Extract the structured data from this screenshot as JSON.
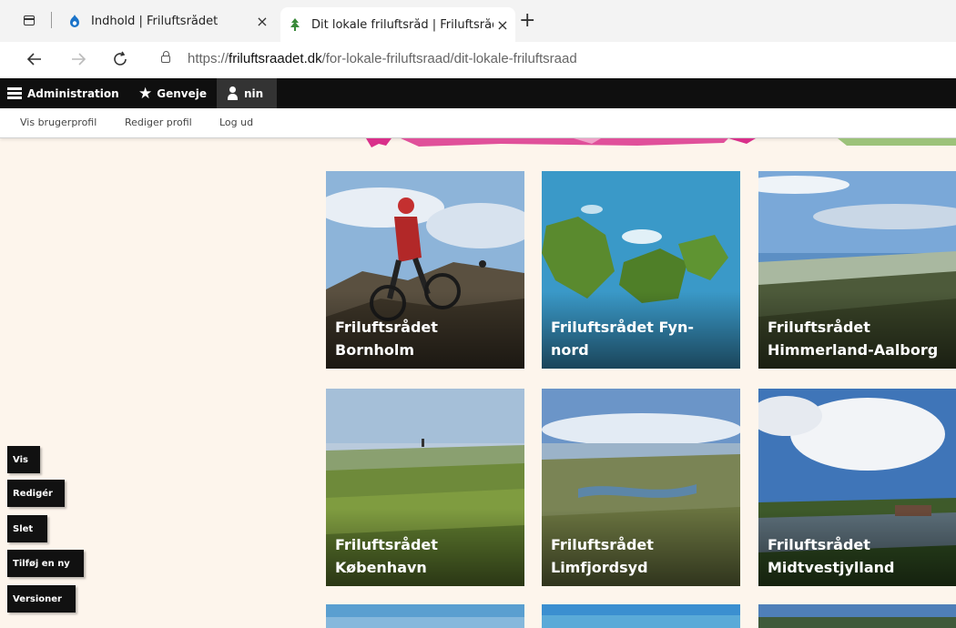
{
  "browser": {
    "tabs": [
      {
        "title": "Indhold | Friluftsrådet"
      },
      {
        "title": "Dit lokale friluftsråd | Friluftsråde"
      }
    ],
    "close_glyph": "×",
    "new_tab_glyph": "+",
    "url_prefix": "https://",
    "url_domain": "friluftsraadet.dk",
    "url_path": "/for-lokale-friluftsraad/dit-lokale-friluftsraad"
  },
  "toolbar": {
    "admin_label": "Administration",
    "shortcuts_label": "Genveje",
    "user_label": "nin"
  },
  "tray": {
    "links": [
      "Vis brugerprofil",
      "Rediger profil",
      "Log ud"
    ]
  },
  "cards": [
    {
      "line1": "Friluftsrådet",
      "line2": "Bornholm"
    },
    {
      "line1": "Friluftsrådet Fyn-",
      "line2": "nord"
    },
    {
      "line1": "Friluftsrådet",
      "line2": "Himmerland-Aalborg"
    },
    {
      "line1": "Friluftsrådet",
      "line2": "København"
    },
    {
      "line1": "Friluftsrådet",
      "line2": "Limfjordsyd"
    },
    {
      "line1": "Friluftsrådet",
      "line2": "Midtvestjylland"
    }
  ],
  "local_tasks": [
    "Vis",
    "Redigér",
    "Slet",
    "Tilføj en ny",
    "Versioner"
  ],
  "colors": {
    "page_background": "#fdf5ec",
    "toolbar": "#0f0f0f",
    "active_user_item": "#333333"
  },
  "icons": [
    "tab-actions-icon",
    "drupal-favicon",
    "friluftsraadet-favicon",
    "back-arrow-icon",
    "forward-arrow-icon",
    "reload-icon",
    "lock-icon",
    "hamburger-icon",
    "star-icon",
    "user-icon"
  ]
}
